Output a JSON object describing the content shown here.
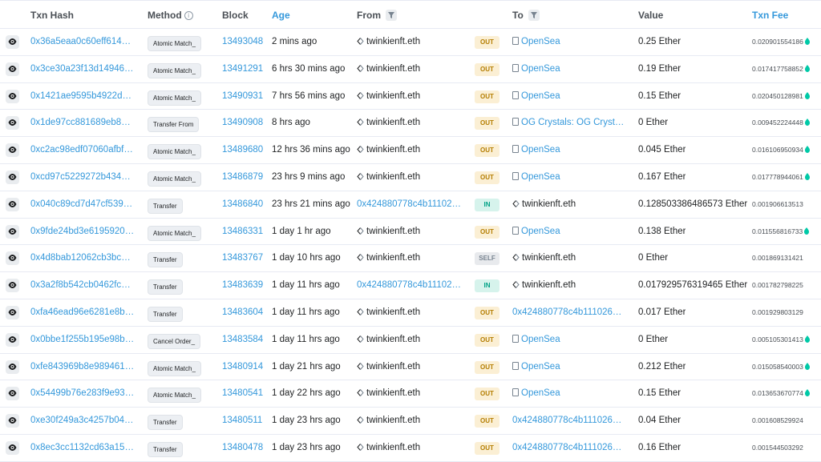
{
  "header": {
    "txn_hash": "Txn Hash",
    "method": "Method",
    "method_info": "i",
    "block": "Block",
    "age": "Age",
    "from": "From",
    "to": "To",
    "value": "Value",
    "txn_fee": "Txn Fee"
  },
  "colors": {
    "link": "#3498db",
    "out_badge_bg": "#fbefd4",
    "out_badge_text": "#b47d00",
    "in_badge_bg": "#d6f3ec",
    "in_badge_text": "#00a186",
    "self_badge_bg": "#e8eaed",
    "gas_green": "#00c9a7"
  },
  "rows": [
    {
      "hash": "0x36a5eaa0c60eff61456…",
      "method": "Atomic Match_",
      "block": "13493048",
      "age": "2 mins ago",
      "from": "twinkienft.eth",
      "from_is_address": false,
      "direction": "OUT",
      "to": "OpenSea",
      "to_type": "contract",
      "value": "0.25 Ether",
      "fee": "0.020901554186"
    },
    {
      "hash": "0x3ce30a23f13d149465…",
      "method": "Atomic Match_",
      "block": "13491291",
      "age": "6 hrs 30 mins ago",
      "from": "twinkienft.eth",
      "from_is_address": false,
      "direction": "OUT",
      "to": "OpenSea",
      "to_type": "contract",
      "value": "0.19 Ether",
      "fee": "0.017417758852"
    },
    {
      "hash": "0x1421ae9595b4922d83…",
      "method": "Atomic Match_",
      "block": "13490931",
      "age": "7 hrs 56 mins ago",
      "from": "twinkienft.eth",
      "from_is_address": false,
      "direction": "OUT",
      "to": "OpenSea",
      "to_type": "contract",
      "value": "0.15 Ether",
      "fee": "0.020450128981"
    },
    {
      "hash": "0x1de97cc881689eb89d…",
      "method": "Transfer From",
      "block": "13490908",
      "age": "8 hrs ago",
      "from": "twinkienft.eth",
      "from_is_address": false,
      "direction": "OUT",
      "to": "OG Crystals: OG Crystal…",
      "to_type": "contract",
      "value": "0 Ether",
      "fee": "0.009452224448"
    },
    {
      "hash": "0xc2ac98edf07060afbf8…",
      "method": "Atomic Match_",
      "block": "13489680",
      "age": "12 hrs 36 mins ago",
      "from": "twinkienft.eth",
      "from_is_address": false,
      "direction": "OUT",
      "to": "OpenSea",
      "to_type": "contract",
      "value": "0.045 Ether",
      "fee": "0.016106950934"
    },
    {
      "hash": "0xcd97c5229272b43462…",
      "method": "Atomic Match_",
      "block": "13486879",
      "age": "23 hrs 9 mins ago",
      "from": "twinkienft.eth",
      "from_is_address": false,
      "direction": "OUT",
      "to": "OpenSea",
      "to_type": "contract",
      "value": "0.167 Ether",
      "fee": "0.017778944061"
    },
    {
      "hash": "0x040c89cd7d47cf53967…",
      "method": "Transfer",
      "block": "13486840",
      "age": "23 hrs 21 mins ago",
      "from": "0x424880778c4b111026…",
      "from_is_address": true,
      "direction": "IN",
      "to": "twinkienft.eth",
      "to_type": "ens",
      "value": "0.128503386486573 Ether",
      "fee": "0.001906613513"
    },
    {
      "hash": "0x9fde24bd3e61959209…",
      "method": "Atomic Match_",
      "block": "13486331",
      "age": "1 day 1 hr ago",
      "from": "twinkienft.eth",
      "from_is_address": false,
      "direction": "OUT",
      "to": "OpenSea",
      "to_type": "contract",
      "value": "0.138 Ether",
      "fee": "0.011556816733"
    },
    {
      "hash": "0x4d8bab12062cb3bc52…",
      "method": "Transfer",
      "block": "13483767",
      "age": "1 day 10 hrs ago",
      "from": "twinkienft.eth",
      "from_is_address": false,
      "direction": "SELF",
      "to": "twinkienft.eth",
      "to_type": "ens",
      "value": "0 Ether",
      "fee": "0.001869131421"
    },
    {
      "hash": "0x3a2f8b542cb0462fc23…",
      "method": "Transfer",
      "block": "13483639",
      "age": "1 day 11 hrs ago",
      "from": "0x424880778c4b111026…",
      "from_is_address": true,
      "direction": "IN",
      "to": "twinkienft.eth",
      "to_type": "ens",
      "value": "0.017929576319465 Ether",
      "fee": "0.001782798225"
    },
    {
      "hash": "0xfa46ead96e6281e8be…",
      "method": "Transfer",
      "block": "13483604",
      "age": "1 day 11 hrs ago",
      "from": "twinkienft.eth",
      "from_is_address": false,
      "direction": "OUT",
      "to": "0x424880778c4b111026…",
      "to_type": "address",
      "value": "0.017 Ether",
      "fee": "0.001929803129"
    },
    {
      "hash": "0x0bbe1f255b195e98bb…",
      "method": "Cancel Order_",
      "block": "13483584",
      "age": "1 day 11 hrs ago",
      "from": "twinkienft.eth",
      "from_is_address": false,
      "direction": "OUT",
      "to": "OpenSea",
      "to_type": "contract",
      "value": "0 Ether",
      "fee": "0.005105301413"
    },
    {
      "hash": "0xfe843969b8e9894610…",
      "method": "Atomic Match_",
      "block": "13480914",
      "age": "1 day 21 hrs ago",
      "from": "twinkienft.eth",
      "from_is_address": false,
      "direction": "OUT",
      "to": "OpenSea",
      "to_type": "contract",
      "value": "0.212 Ether",
      "fee": "0.015058540003"
    },
    {
      "hash": "0x54499b76e283f9e939…",
      "method": "Atomic Match_",
      "block": "13480541",
      "age": "1 day 22 hrs ago",
      "from": "twinkienft.eth",
      "from_is_address": false,
      "direction": "OUT",
      "to": "OpenSea",
      "to_type": "contract",
      "value": "0.15 Ether",
      "fee": "0.013653670774"
    },
    {
      "hash": "0xe30f249a3c4257b04c…",
      "method": "Transfer",
      "block": "13480511",
      "age": "1 day 23 hrs ago",
      "from": "twinkienft.eth",
      "from_is_address": false,
      "direction": "OUT",
      "to": "0x424880778c4b111026…",
      "to_type": "address",
      "value": "0.04 Ether",
      "fee": "0.001608529924"
    },
    {
      "hash": "0x8ec3cc1132cd63a152…",
      "method": "Transfer",
      "block": "13480478",
      "age": "1 day 23 hrs ago",
      "from": "twinkienft.eth",
      "from_is_address": false,
      "direction": "OUT",
      "to": "0x424880778c4b111026…",
      "to_type": "address",
      "value": "0.16 Ether",
      "fee": "0.001544503292"
    }
  ]
}
